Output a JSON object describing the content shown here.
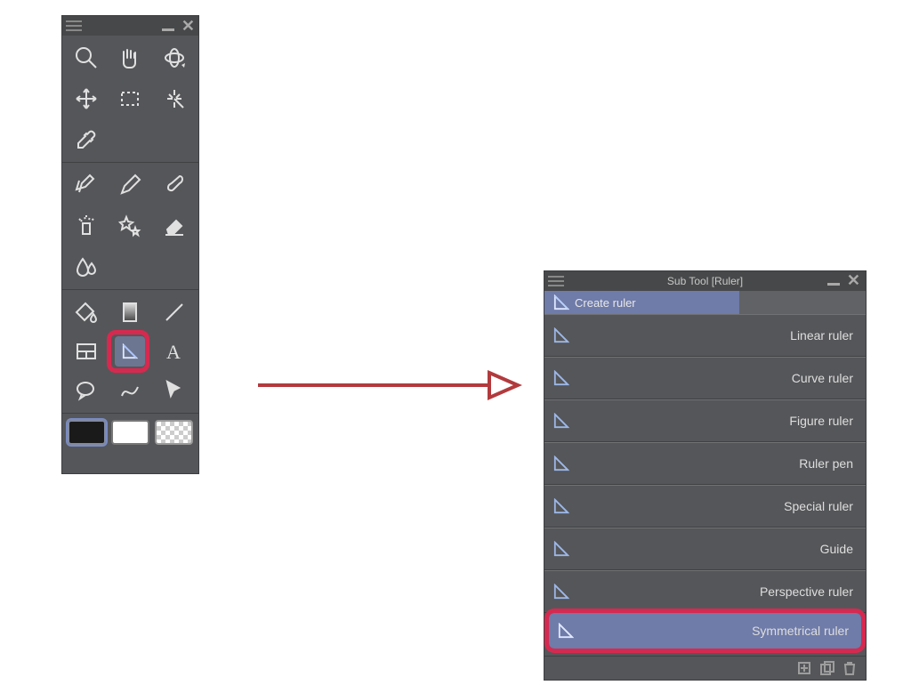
{
  "tool_palette": {
    "tools": [
      "magnifier",
      "hand",
      "object-3d",
      "move",
      "marquee",
      "wand",
      "eyedropper",
      "",
      "",
      "pen",
      "pencil",
      "brush",
      "airbrush",
      "decoration",
      "eraser",
      "blend",
      "",
      "",
      "fill",
      "gradient",
      "line",
      "figure",
      "ruler",
      "text",
      "balloon",
      "correct",
      "pointer"
    ],
    "colors": {
      "foreground": "#000000",
      "background": "#ffffff",
      "transparent": "transparent"
    }
  },
  "sub_tool_panel": {
    "title": "Sub Tool [Ruler]",
    "tab": "Create ruler",
    "items": [
      "Linear ruler",
      "Curve ruler",
      "Figure ruler",
      "Ruler pen",
      "Special ruler",
      "Guide",
      "Perspective ruler",
      "Symmetrical ruler"
    ],
    "selected": "Symmetrical ruler"
  },
  "highlight_color": "#d7294f"
}
